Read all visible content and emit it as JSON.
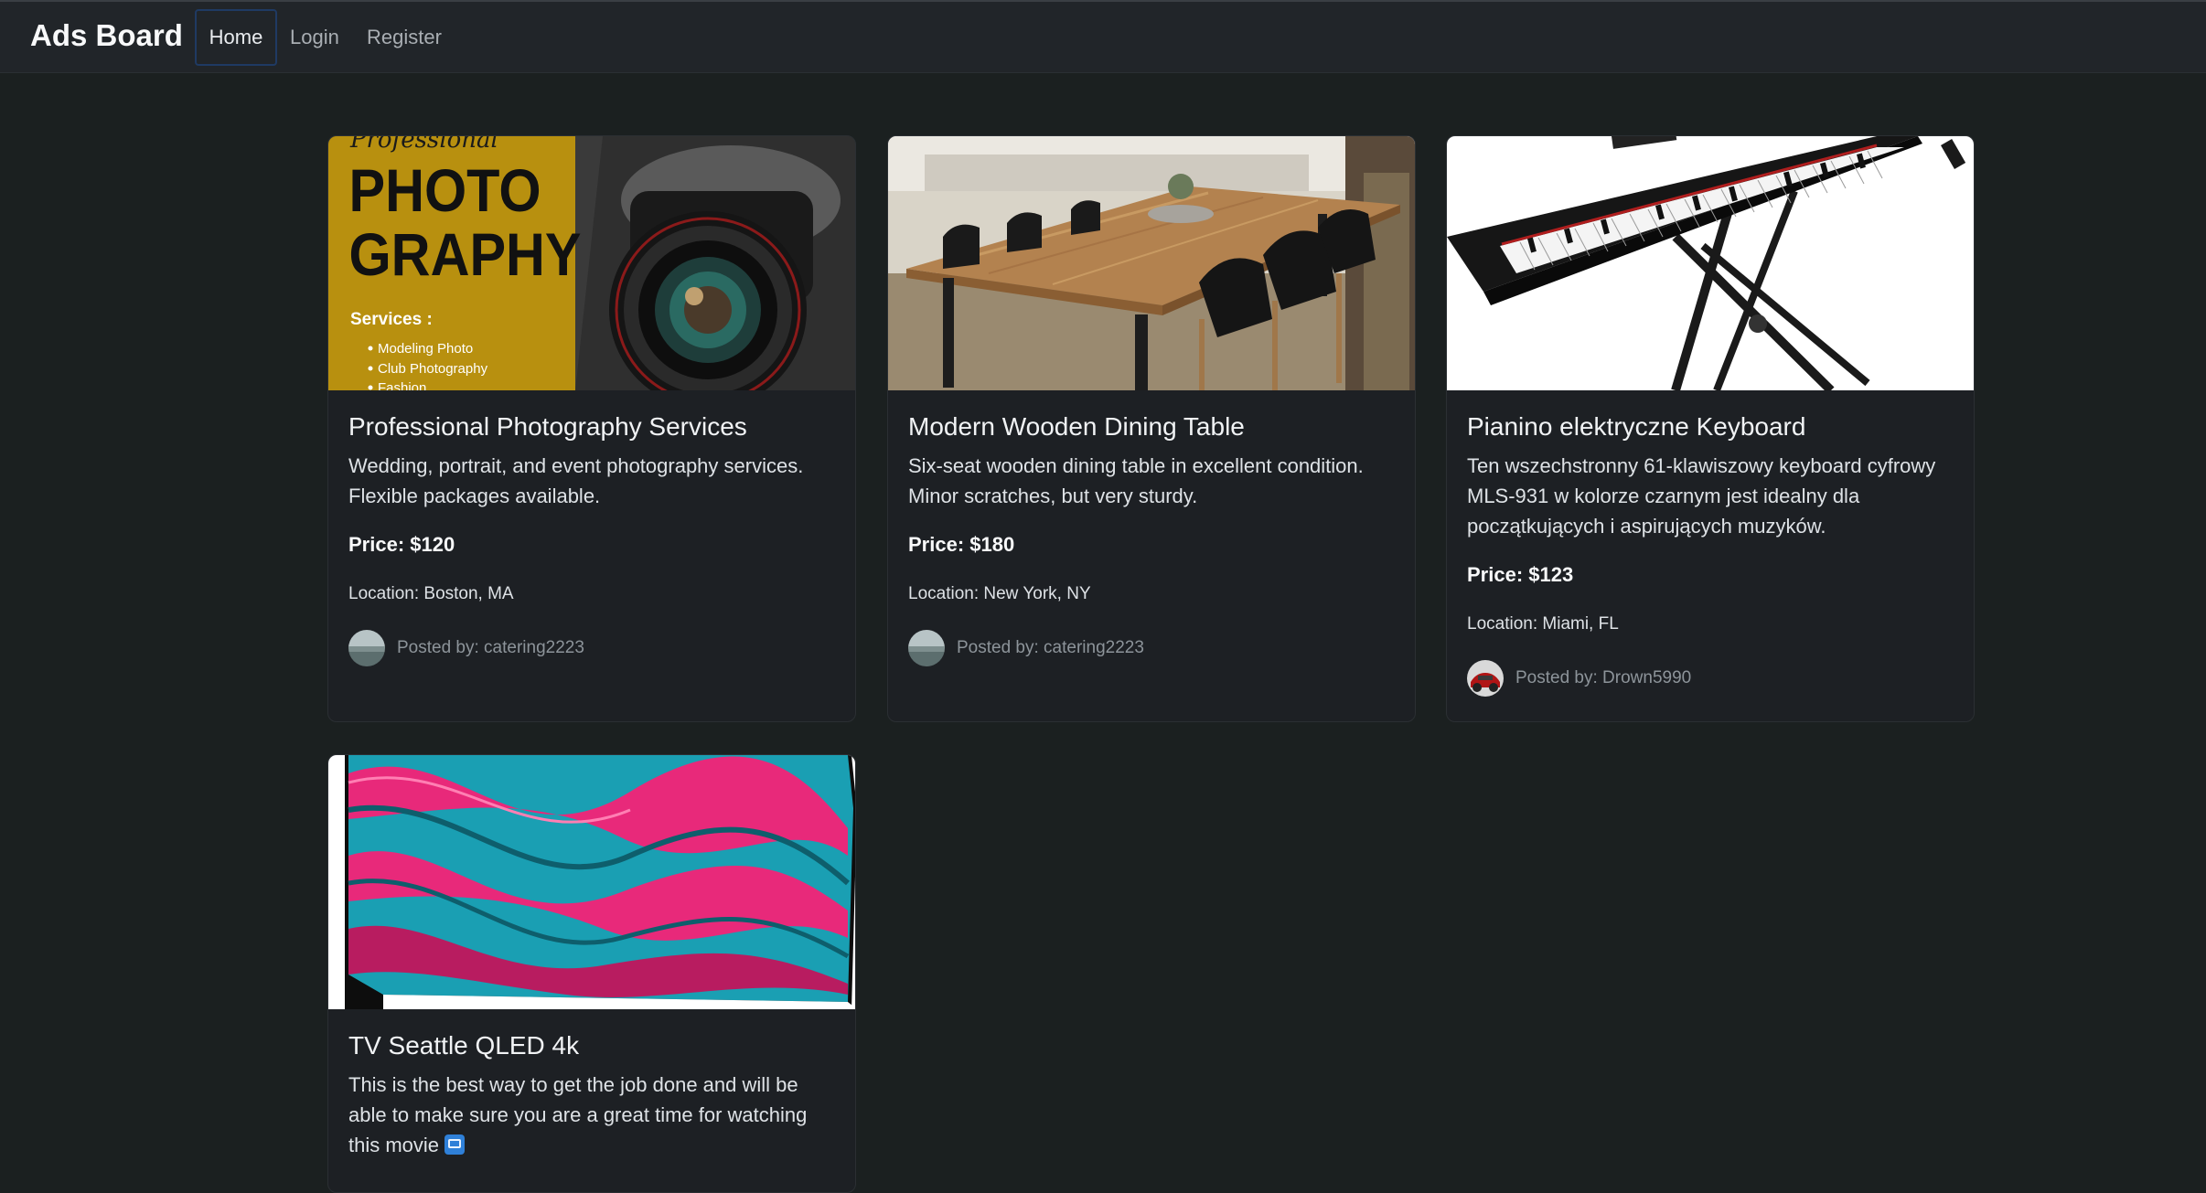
{
  "navbar": {
    "brand": "Ads Board",
    "links": [
      "Home",
      "Login",
      "Register"
    ]
  },
  "ads": [
    {
      "title": "Professional Photography Services",
      "description": "Wedding, portrait, and event photography services. Flexible packages available.",
      "price": "Price: $120",
      "location": "Location: Boston, MA",
      "posted_by": "Posted by: catering2223",
      "image_text": {
        "script": "Professional",
        "line1": "PHOTO",
        "line2": "GRAPHY",
        "services_title": "Services :",
        "services": [
          "Modeling Photo",
          "Club Photography",
          "Fashion"
        ]
      }
    },
    {
      "title": "Modern Wooden Dining Table",
      "description": "Six-seat wooden dining table in excellent condition. Minor scratches, but very sturdy.",
      "price": "Price: $180",
      "location": "Location: New York, NY",
      "posted_by": "Posted by: catering2223"
    },
    {
      "title": "Pianino elektryczne Keyboard",
      "description": "Ten wszechstronny 61-klawiszowy keyboard cyfrowy MLS-931 w kolorze czarnym jest idealny dla początkujących i aspirujących muzyków.",
      "price": "Price: $123",
      "location": "Location: Miami, FL",
      "posted_by": "Posted by: Drown5990"
    },
    {
      "title": "TV Seattle QLED 4k",
      "description": "This is the best way to get the job done and will be able to make sure you are a great time for watching this movie",
      "emoji": "tv-icon"
    }
  ],
  "colors": {
    "background": "#1b2020",
    "navbar": "#212529",
    "card": "#1d2024",
    "photo_banner": "#b8900f"
  }
}
